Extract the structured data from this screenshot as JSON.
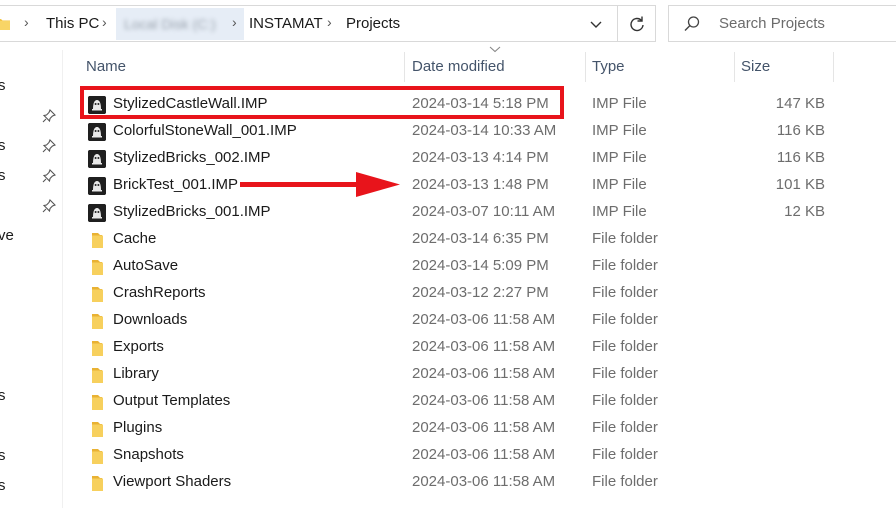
{
  "address_bar": {
    "crumbs": [
      "This PC",
      "INSTAMAT",
      "Projects"
    ],
    "blurred_crumb": "Local Disk (C:)"
  },
  "search": {
    "placeholder": "Search Projects"
  },
  "nav_fragments": [
    "s",
    "s",
    "s",
    "ve",
    "s",
    "s",
    "s"
  ],
  "columns": {
    "name": "Name",
    "date": "Date modified",
    "type": "Type",
    "size": "Size"
  },
  "files": [
    {
      "name": "StylizedCastleWall.IMP",
      "date": "2024-03-14 5:18 PM",
      "type": "IMP File",
      "size": "147 KB",
      "kind": "imp"
    },
    {
      "name": "ColorfulStoneWall_001.IMP",
      "date": "2024-03-14 10:33 AM",
      "type": "IMP File",
      "size": "116 KB",
      "kind": "imp"
    },
    {
      "name": "StylizedBricks_002.IMP",
      "date": "2024-03-13 4:14 PM",
      "type": "IMP File",
      "size": "116 KB",
      "kind": "imp"
    },
    {
      "name": "BrickTest_001.IMP",
      "date": "2024-03-13 1:48 PM",
      "type": "IMP File",
      "size": "101 KB",
      "kind": "imp"
    },
    {
      "name": "StylizedBricks_001.IMP",
      "date": "2024-03-07 10:11 AM",
      "type": "IMP File",
      "size": "12 KB",
      "kind": "imp"
    },
    {
      "name": "Cache",
      "date": "2024-03-14 6:35 PM",
      "type": "File folder",
      "size": "",
      "kind": "folder"
    },
    {
      "name": "AutoSave",
      "date": "2024-03-14 5:09 PM",
      "type": "File folder",
      "size": "",
      "kind": "folder"
    },
    {
      "name": "CrashReports",
      "date": "2024-03-12 2:27 PM",
      "type": "File folder",
      "size": "",
      "kind": "folder"
    },
    {
      "name": "Downloads",
      "date": "2024-03-06 11:58 AM",
      "type": "File folder",
      "size": "",
      "kind": "folder"
    },
    {
      "name": "Exports",
      "date": "2024-03-06 11:58 AM",
      "type": "File folder",
      "size": "",
      "kind": "folder"
    },
    {
      "name": "Library",
      "date": "2024-03-06 11:58 AM",
      "type": "File folder",
      "size": "",
      "kind": "folder"
    },
    {
      "name": "Output Templates",
      "date": "2024-03-06 11:58 AM",
      "type": "File folder",
      "size": "",
      "kind": "folder"
    },
    {
      "name": "Plugins",
      "date": "2024-03-06 11:58 AM",
      "type": "File folder",
      "size": "",
      "kind": "folder"
    },
    {
      "name": "Snapshots",
      "date": "2024-03-06 11:58 AM",
      "type": "File folder",
      "size": "",
      "kind": "folder"
    },
    {
      "name": "Viewport Shaders",
      "date": "2024-03-06 11:58 AM",
      "type": "File folder",
      "size": "",
      "kind": "folder"
    }
  ],
  "annotations": {
    "highlight_color": "#e8141b",
    "arrow_color": "#e8141b"
  },
  "icons": {
    "folder": "folder-icon",
    "imp": "instamat-project-icon",
    "pin": "pin-icon",
    "search": "search-icon",
    "refresh": "refresh-icon",
    "dropdown": "chevron-down-icon"
  }
}
